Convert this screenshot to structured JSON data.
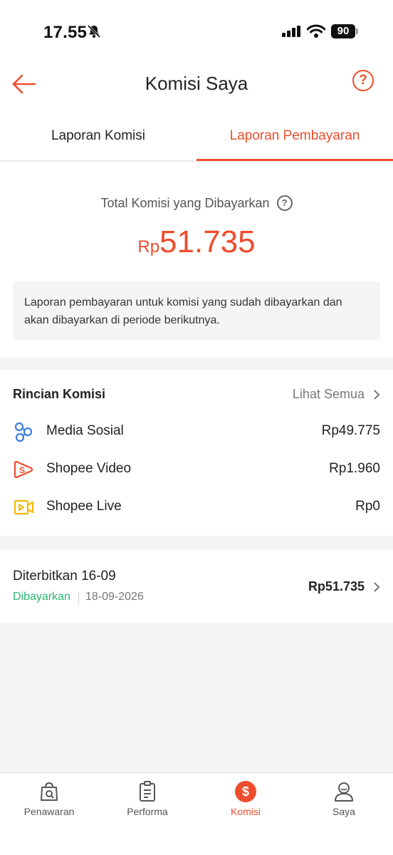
{
  "status_bar": {
    "time": "17.55",
    "battery": "90"
  },
  "header": {
    "title": "Komisi Saya",
    "help_symbol": "?"
  },
  "tabs": [
    {
      "label": "Laporan Komisi",
      "active": false
    },
    {
      "label": "Laporan Pembayaran",
      "active": true
    }
  ],
  "summary": {
    "label": "Total Komisi yang Dibayarkan",
    "currency": "Rp",
    "amount": "51.735",
    "info": "Laporan pembayaran untuk komisi yang sudah dibayarkan dan akan dibayarkan di periode berikutnya."
  },
  "rincian": {
    "title": "Rincian Komisi",
    "see_all": "Lihat Semua",
    "items": [
      {
        "name": "Media Sosial",
        "value": "Rp49.775",
        "icon": "social-network-icon"
      },
      {
        "name": "Shopee Video",
        "value": "Rp1.960",
        "icon": "shopee-video-icon"
      },
      {
        "name": "Shopee Live",
        "value": "Rp0",
        "icon": "shopee-live-icon"
      }
    ]
  },
  "payout": {
    "title": "Diterbitkan 16-09",
    "status": "Dibayarkan",
    "date": "18-09-2026",
    "amount": "Rp51.735"
  },
  "bottom_nav": [
    {
      "label": "Penawaran",
      "icon": "offer-bag-icon",
      "active": false
    },
    {
      "label": "Performa",
      "icon": "clipboard-icon",
      "active": false
    },
    {
      "label": "Komisi",
      "icon": "dollar-icon",
      "active": true
    },
    {
      "label": "Saya",
      "icon": "user-icon",
      "active": false
    }
  ],
  "colors": {
    "accent": "#ee4d2d",
    "paid_status": "#2bb673",
    "live_icon": "#f5b800",
    "social_icon": "#3b7ddd"
  }
}
